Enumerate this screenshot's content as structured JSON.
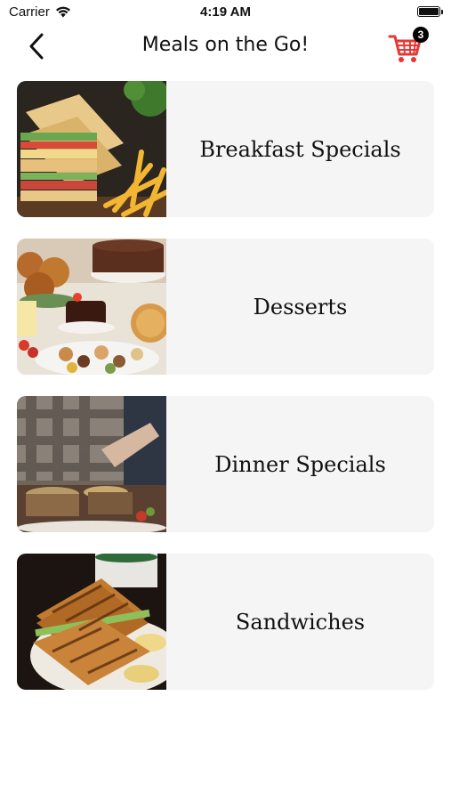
{
  "status_bar": {
    "carrier": "Carrier",
    "time": "4:19 AM"
  },
  "nav": {
    "title": "Meals on the Go!",
    "cart_count": "3"
  },
  "colors": {
    "accent": "#e53935",
    "card_bg": "#f5f5f5"
  },
  "categories": [
    {
      "label": "Breakfast Specials",
      "image": "club-sandwich-fries-photo"
    },
    {
      "label": "Desserts",
      "image": "dessert-platter-photo"
    },
    {
      "label": "Dinner Specials",
      "image": "buffet-serving-photo"
    },
    {
      "label": "Sandwiches",
      "image": "grilled-sandwich-photo"
    }
  ]
}
